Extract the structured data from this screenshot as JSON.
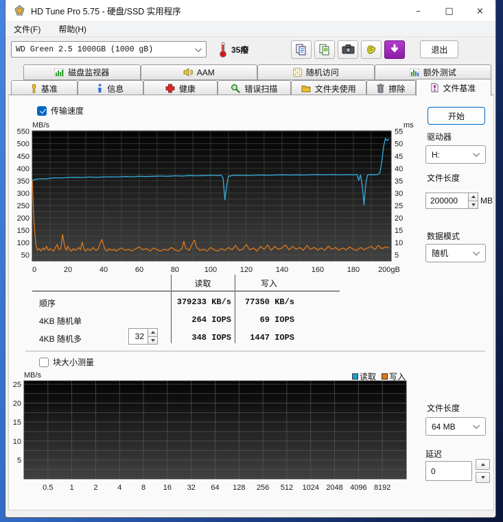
{
  "window": {
    "title": "HD Tune Pro 5.75 - 硬盘/SSD 实用程序"
  },
  "menu": {
    "items": [
      "文件(F)",
      "帮助(H)"
    ]
  },
  "toolbar": {
    "drive_select": "WD Green 2.5 1000GB (1000 gB)",
    "temperature": "35癈",
    "exit_label": "退出",
    "icons": {
      "thermometer": "thermometer-icon",
      "copy_text": "copy-text-icon",
      "copy_image": "copy-image-icon",
      "camera": "camera-icon",
      "hand": "hand-icon",
      "download": "download-icon"
    }
  },
  "tabs": {
    "row1": [
      {
        "label": "磁盘监视器"
      },
      {
        "label": "AAM"
      },
      {
        "label": "随机访问"
      },
      {
        "label": "额外测试"
      }
    ],
    "row2": [
      {
        "label": "基准"
      },
      {
        "label": "信息"
      },
      {
        "label": "健康"
      },
      {
        "label": "错误扫描"
      },
      {
        "label": "文件夹使用"
      },
      {
        "label": "擦除"
      },
      {
        "label": "文件基准",
        "active": true
      }
    ]
  },
  "file_benchmark": {
    "transfer_checkbox": "传输速度",
    "transfer_checked": true,
    "start_button": "开始",
    "drive_label": "驱动器",
    "drive_value": "H:",
    "file_length_label": "文件长度",
    "file_length_value": "200000",
    "file_length_unit": "MB",
    "data_mode_label": "数据模式",
    "data_mode_value": "随机",
    "table": {
      "col_headers": [
        "读取",
        "写入"
      ],
      "rows": [
        {
          "label": "顺序",
          "read": "379233 KB/s",
          "write": "77350 KB/s"
        },
        {
          "label": "4KB 随机单",
          "read": "264 IOPS",
          "write": "69 IOPS"
        },
        {
          "label": "4KB 随机多",
          "queue": "32",
          "read": "348 IOPS",
          "write": "1447 IOPS"
        }
      ]
    },
    "block_checkbox": "块大小测量",
    "block_checked": false,
    "block_file_length_label": "文件长度",
    "block_file_length_value": "64 MB",
    "delay_label": "延迟",
    "delay_value": "0"
  },
  "chart_data": [
    {
      "type": "line",
      "title": "传输速度",
      "ylabel": "MB/s",
      "y2label": "ms",
      "xlabel": "",
      "ylim": [
        25,
        552
      ],
      "y2lim": [
        2.5,
        55.2
      ],
      "grid": true,
      "yticks": [
        550,
        500,
        450,
        400,
        350,
        300,
        250,
        200,
        150,
        100,
        50
      ],
      "y2ticks": [
        55,
        50,
        45,
        40,
        35,
        30,
        25,
        20,
        15,
        10,
        5
      ],
      "xticks": [
        [
          0,
          "0"
        ],
        [
          20,
          "20"
        ],
        [
          40,
          "40"
        ],
        [
          60,
          "60"
        ],
        [
          80,
          "80"
        ],
        [
          100,
          "100"
        ],
        [
          120,
          "120"
        ],
        [
          140,
          "140"
        ],
        [
          160,
          "160"
        ],
        [
          180,
          "180"
        ],
        [
          200,
          "200gB"
        ]
      ],
      "colors": {
        "plot_bg_top": "#030303",
        "plot_bg_bottom": "#414141",
        "grid": "#515a51"
      },
      "series": [
        {
          "name": "读取",
          "color": "#35aede",
          "points": [
            [
              0,
              352
            ],
            [
              2,
              356
            ],
            [
              5,
              358
            ],
            [
              8,
              357
            ],
            [
              10,
              360
            ],
            [
              13,
              362
            ],
            [
              16,
              361
            ],
            [
              20,
              363
            ],
            [
              24,
              364
            ],
            [
              28,
              363
            ],
            [
              32,
              365
            ],
            [
              36,
              364
            ],
            [
              40,
              365
            ],
            [
              44,
              366
            ],
            [
              48,
              365
            ],
            [
              52,
              367
            ],
            [
              56,
              366
            ],
            [
              60,
              368
            ],
            [
              64,
              367
            ],
            [
              68,
              368
            ],
            [
              72,
              369
            ],
            [
              76,
              368
            ],
            [
              80,
              370
            ],
            [
              84,
              369
            ],
            [
              88,
              371
            ],
            [
              92,
              370
            ],
            [
              96,
              371
            ],
            [
              100,
              372
            ],
            [
              104,
              371
            ],
            [
              106,
              372
            ],
            [
              107,
              360
            ],
            [
              108,
              272
            ],
            [
              109,
              330
            ],
            [
              110,
              368
            ],
            [
              112,
              371
            ],
            [
              116,
              372
            ],
            [
              120,
              371
            ],
            [
              124,
              372
            ],
            [
              128,
              373
            ],
            [
              132,
              372
            ],
            [
              136,
              373
            ],
            [
              140,
              374
            ],
            [
              144,
              373
            ],
            [
              148,
              374
            ],
            [
              152,
              373
            ],
            [
              156,
              374
            ],
            [
              160,
              375
            ],
            [
              164,
              374
            ],
            [
              168,
              375
            ],
            [
              172,
              374
            ],
            [
              176,
              375
            ],
            [
              180,
              374
            ],
            [
              182,
              376
            ],
            [
              183,
              352
            ],
            [
              184,
              374
            ],
            [
              185,
              330
            ],
            [
              186,
              252
            ],
            [
              187,
              340
            ],
            [
              188,
              374
            ],
            [
              190,
              375
            ],
            [
              192,
              374
            ],
            [
              194,
              376
            ],
            [
              195,
              385
            ],
            [
              196,
              430
            ],
            [
              197,
              490
            ],
            [
              198,
              522
            ],
            [
              199,
              512
            ],
            [
              200,
              520
            ]
          ]
        },
        {
          "name": "写入",
          "color": "#e07818",
          "points": [
            [
              0,
              350
            ],
            [
              1,
              180
            ],
            [
              2,
              90
            ],
            [
              3,
              68
            ],
            [
              4,
              75
            ],
            [
              5,
              65
            ],
            [
              6,
              78
            ],
            [
              7,
              70
            ],
            [
              8,
              85
            ],
            [
              9,
              68
            ],
            [
              10,
              75
            ],
            [
              11,
              70
            ],
            [
              12,
              65
            ],
            [
              13,
              80
            ],
            [
              14,
              92
            ],
            [
              15,
              70
            ],
            [
              16,
              75
            ],
            [
              17,
              133
            ],
            [
              18,
              90
            ],
            [
              19,
              68
            ],
            [
              20,
              85
            ],
            [
              21,
              70
            ],
            [
              22,
              65
            ],
            [
              23,
              75
            ],
            [
              24,
              68
            ],
            [
              25,
              72
            ],
            [
              26,
              80
            ],
            [
              27,
              70
            ],
            [
              28,
              102
            ],
            [
              29,
              72
            ],
            [
              30,
              65
            ],
            [
              31,
              75
            ],
            [
              32,
              70
            ],
            [
              33,
              68
            ],
            [
              34,
              80
            ],
            [
              35,
              72
            ],
            [
              36,
              68
            ],
            [
              37,
              75
            ],
            [
              38,
              95
            ],
            [
              39,
              112
            ],
            [
              40,
              88
            ],
            [
              41,
              70
            ],
            [
              42,
              65
            ],
            [
              43,
              75
            ],
            [
              44,
              70
            ],
            [
              45,
              68
            ],
            [
              46,
              72
            ],
            [
              47,
              65
            ],
            [
              48,
              70
            ],
            [
              50,
              78
            ],
            [
              52,
              68
            ],
            [
              54,
              72
            ],
            [
              56,
              65
            ],
            [
              58,
              75
            ],
            [
              60,
              82
            ],
            [
              62,
              70
            ],
            [
              64,
              75
            ],
            [
              66,
              65
            ],
            [
              68,
              78
            ],
            [
              70,
              70
            ],
            [
              72,
              65
            ],
            [
              74,
              72
            ],
            [
              76,
              68
            ],
            [
              78,
              80
            ],
            [
              80,
              70
            ],
            [
              82,
              65
            ],
            [
              84,
              75
            ],
            [
              85,
              105
            ],
            [
              86,
              78
            ],
            [
              88,
              68
            ],
            [
              90,
              98
            ],
            [
              91,
              110
            ],
            [
              92,
              82
            ],
            [
              94,
              68
            ],
            [
              96,
              72
            ],
            [
              98,
              65
            ],
            [
              100,
              80
            ],
            [
              102,
              70
            ],
            [
              104,
              65
            ],
            [
              106,
              75
            ],
            [
              108,
              68
            ],
            [
              110,
              80
            ],
            [
              112,
              70
            ],
            [
              114,
              88
            ],
            [
              116,
              68
            ],
            [
              118,
              72
            ],
            [
              120,
              92
            ],
            [
              122,
              70
            ],
            [
              124,
              78
            ],
            [
              126,
              65
            ],
            [
              128,
              85
            ],
            [
              130,
              72
            ],
            [
              132,
              90
            ],
            [
              134,
              68
            ],
            [
              136,
              85
            ],
            [
              138,
              72
            ],
            [
              140,
              78
            ],
            [
              142,
              90
            ],
            [
              144,
              70
            ],
            [
              146,
              85
            ],
            [
              148,
              72
            ],
            [
              150,
              80
            ],
            [
              152,
              68
            ],
            [
              154,
              88
            ],
            [
              156,
              72
            ],
            [
              158,
              80
            ],
            [
              160,
              70
            ],
            [
              162,
              78
            ],
            [
              164,
              68
            ],
            [
              166,
              85
            ],
            [
              168,
              72
            ],
            [
              170,
              80
            ],
            [
              172,
              68
            ],
            [
              174,
              78
            ],
            [
              176,
              70
            ],
            [
              178,
              82
            ],
            [
              180,
              72
            ],
            [
              182,
              68
            ],
            [
              184,
              80
            ],
            [
              186,
              70
            ],
            [
              188,
              78
            ],
            [
              190,
              85
            ],
            [
              192,
              72
            ],
            [
              194,
              88
            ],
            [
              196,
              75
            ],
            [
              198,
              82
            ],
            [
              200,
              78
            ]
          ]
        }
      ]
    },
    {
      "type": "line",
      "title": "块大小测量",
      "ylabel": "MB/s",
      "ylim": [
        0,
        25.9
      ],
      "grid": true,
      "yticks": [
        25,
        20,
        15,
        10,
        5
      ],
      "xtick_labels": [
        "0.5",
        "1",
        "2",
        "4",
        "8",
        "16",
        "32",
        "64",
        "128",
        "256",
        "512",
        "1024",
        "2048",
        "4096",
        "8192"
      ],
      "legend_position": "top-right",
      "colors": {
        "plot_bg_top": "#030303",
        "plot_bg_bottom": "#414141",
        "grid": "#565e56"
      },
      "series": [
        {
          "name": "读取",
          "color": "#1b9cd0",
          "points": []
        },
        {
          "name": "写入",
          "color": "#e07818",
          "points": []
        }
      ]
    }
  ]
}
